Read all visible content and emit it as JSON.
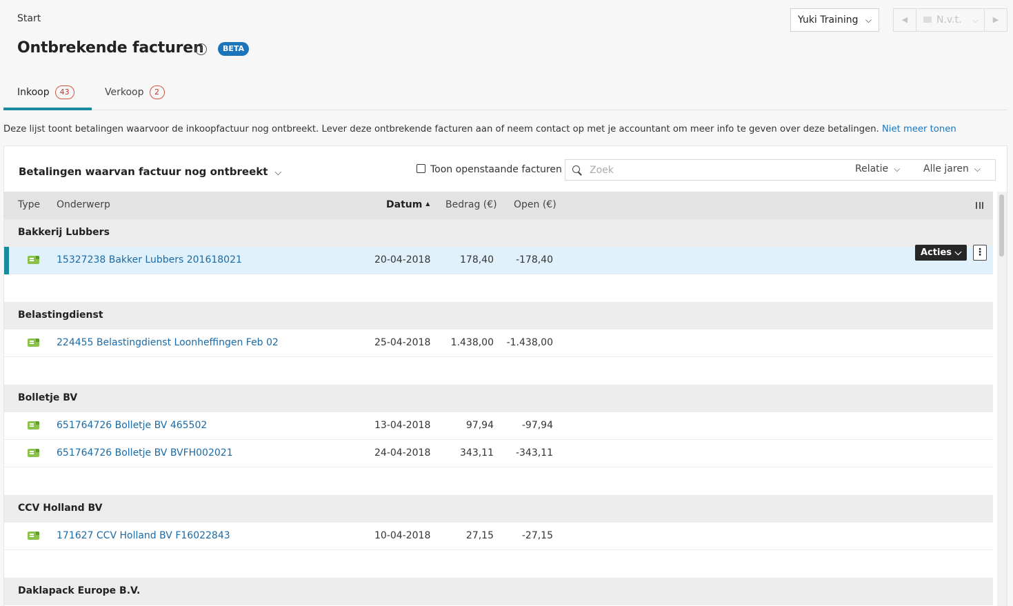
{
  "breadcrumb": "Start",
  "page": {
    "title": "Ontbrekende facturen",
    "beta_label": "BETA",
    "info_glyph": "i"
  },
  "header": {
    "company": "Yuki Training",
    "period": "N.v.t.",
    "prev_glyph": "◀",
    "next_glyph": "▶",
    "chevron": "⌵"
  },
  "tabs": [
    {
      "label": "Inkoop",
      "count": "43",
      "active": true
    },
    {
      "label": "Verkoop",
      "count": "2",
      "active": false
    }
  ],
  "notice": {
    "text": "Deze lijst toont betalingen waarvoor de inkoopfactuur nog ontbreekt. Lever deze ontbrekende facturen aan of neem contact op met je accountant om meer info te geven over deze betalingen. ",
    "link": "Niet meer tonen"
  },
  "panel": {
    "title": "Betalingen waarvan factuur nog ontbreekt",
    "toggle_label": "Toon openstaande facturen",
    "search_placeholder": "Zoek",
    "filter_relatie": "Relatie",
    "filter_jaren": "Alle jaren"
  },
  "columns": {
    "type": "Type",
    "subject": "Onderwerp",
    "date": "Datum",
    "sort_glyph": "▲",
    "amount": "Bedrag (€)",
    "open": "Open (€)"
  },
  "actions": {
    "acties": "Acties",
    "chevron": "⌵",
    "kebab": "⋮"
  },
  "groups": [
    {
      "name": "Bakkerij Lubbers",
      "rows": [
        {
          "subject": "15327238 Bakker Lubbers 201618021",
          "date": "20-04-2018",
          "amount": "178,40",
          "open": "-178,40"
        }
      ]
    },
    {
      "name": "Belastingdienst",
      "rows": [
        {
          "subject": "224455 Belastingdienst Loonheffingen Feb 02",
          "date": "25-04-2018",
          "amount": "1.438,00",
          "open": "-1.438,00"
        }
      ]
    },
    {
      "name": "Bolletje BV",
      "rows": [
        {
          "subject": "651764726 Bolletje BV 465502",
          "date": "13-04-2018",
          "amount": "97,94",
          "open": "-97,94"
        },
        {
          "subject": "651764726 Bolletje BV BVFH002021",
          "date": "24-04-2018",
          "amount": "343,11",
          "open": "-343,11"
        }
      ]
    },
    {
      "name": "CCV Holland BV",
      "rows": [
        {
          "subject": "171627 CCV Holland BV F16022843",
          "date": "10-04-2018",
          "amount": "27,15",
          "open": "-27,15"
        }
      ]
    },
    {
      "name": "Daklapack Europe B.V.",
      "rows": []
    }
  ]
}
